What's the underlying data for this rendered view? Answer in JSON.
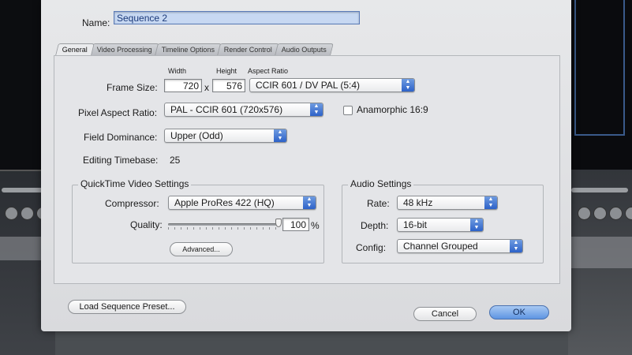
{
  "dialog": {
    "name_label": "Name:",
    "name_value": "Sequence 2",
    "tabs": [
      {
        "label": "General",
        "active": true
      },
      {
        "label": "Video Processing",
        "active": false
      },
      {
        "label": "Timeline Options",
        "active": false
      },
      {
        "label": "Render Control",
        "active": false
      },
      {
        "label": "Audio Outputs",
        "active": false
      }
    ],
    "frame_size": {
      "label": "Frame Size:",
      "width_header": "Width",
      "height_header": "Height",
      "aspect_header": "Aspect Ratio",
      "width": "720",
      "separator": "x",
      "height": "576",
      "aspect_ratio": "CCIR 601 / DV PAL (5:4)"
    },
    "pixel_aspect": {
      "label": "Pixel Aspect Ratio:",
      "value": "PAL - CCIR 601 (720x576)"
    },
    "anamorphic": {
      "label": "Anamorphic 16:9",
      "checked": false
    },
    "field_dominance": {
      "label": "Field Dominance:",
      "value": "Upper (Odd)"
    },
    "editing_timebase": {
      "label": "Editing Timebase:",
      "value": "25"
    },
    "quicktime": {
      "title": "QuickTime Video Settings",
      "compressor_label": "Compressor:",
      "compressor_value": "Apple ProRes 422 (HQ)",
      "quality_label": "Quality:",
      "quality_value": "100",
      "quality_unit": "%",
      "quality_level": 1.0,
      "advanced_button": "Advanced..."
    },
    "audio": {
      "title": "Audio Settings",
      "rate_label": "Rate:",
      "rate_value": "48 kHz",
      "depth_label": "Depth:",
      "depth_value": "16-bit",
      "config_label": "Config:",
      "config_value": "Channel Grouped"
    },
    "buttons": {
      "load_preset": "Load Sequence Preset...",
      "cancel": "Cancel",
      "ok": "OK"
    }
  },
  "icons": {
    "popup_arrows": "▲▼",
    "transport": [
      "◀",
      "▶",
      "⏺",
      "⏹"
    ]
  },
  "colors": {
    "accent": "#3a74d8",
    "selection": "#c7d8f2"
  }
}
